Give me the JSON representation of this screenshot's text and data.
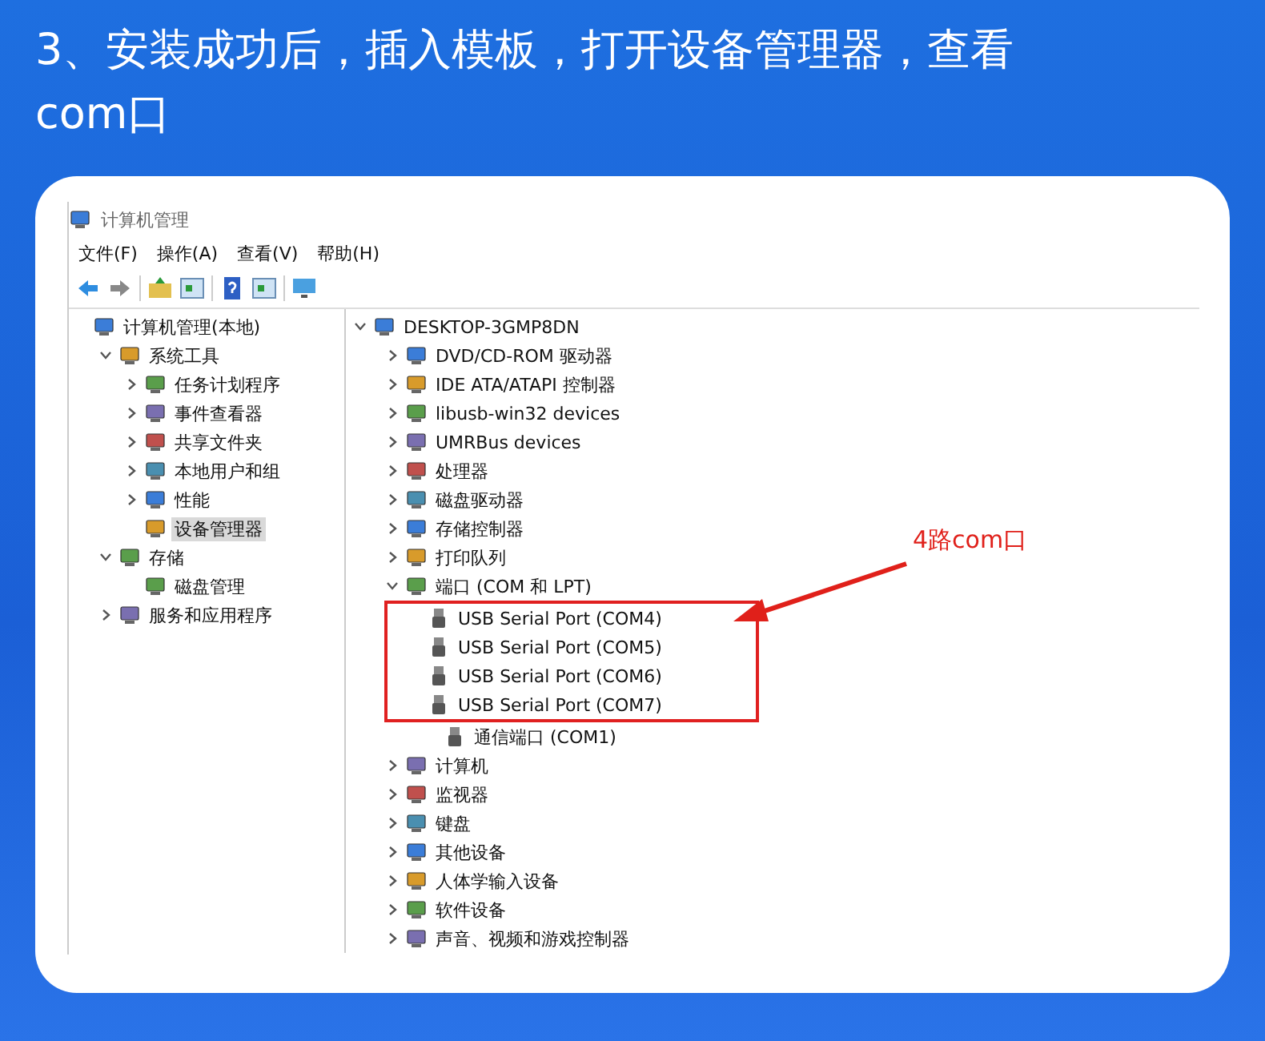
{
  "heading": {
    "lines": [
      "3、安装成功后，插入模板，打开设备管理器，查看",
      "com口"
    ]
  },
  "window": {
    "title": "计算机管理",
    "menu": [
      "文件(F)",
      "操作(A)",
      "查看(V)",
      "帮助(H)"
    ],
    "left_tree": [
      {
        "label": "计算机管理(本地)",
        "selected": false,
        "children": [
          {
            "label": "系统工具",
            "selected": false,
            "expanded": true,
            "children": [
              {
                "label": "任务计划程序",
                "selected": false,
                "expanded": false
              },
              {
                "label": "事件查看器",
                "selected": false,
                "expanded": false
              },
              {
                "label": "共享文件夹",
                "selected": false,
                "expanded": false
              },
              {
                "label": "本地用户和组",
                "selected": false,
                "expanded": false
              },
              {
                "label": "性能",
                "selected": false,
                "expanded": false
              },
              {
                "label": "设备管理器",
                "selected": true
              }
            ]
          },
          {
            "label": "存储",
            "selected": false,
            "expanded": true,
            "children": [
              {
                "label": "磁盘管理",
                "selected": false
              }
            ]
          },
          {
            "label": "服务和应用程序",
            "selected": false,
            "expanded": false
          }
        ]
      }
    ],
    "device_tree": {
      "label": "DESKTOP-3GMP8DN",
      "expanded": true,
      "children": [
        {
          "label": "DVD/CD-ROM 驱动器",
          "expanded": false
        },
        {
          "label": "IDE ATA/ATAPI 控制器",
          "expanded": false
        },
        {
          "label": "libusb-win32 devices",
          "expanded": false
        },
        {
          "label": "UMRBus devices",
          "expanded": false
        },
        {
          "label": "处理器",
          "expanded": false
        },
        {
          "label": "磁盘驱动器",
          "expanded": false
        },
        {
          "label": "存储控制器",
          "expanded": false
        },
        {
          "label": "打印队列",
          "expanded": false
        },
        {
          "label": "端口 (COM 和 LPT)",
          "expanded": true,
          "children": [
            {
              "label": "USB Serial Port (COM4)",
              "highlighted": true
            },
            {
              "label": "USB Serial Port (COM5)",
              "highlighted": true
            },
            {
              "label": "USB Serial Port (COM6)",
              "highlighted": true
            },
            {
              "label": "USB Serial Port (COM7)",
              "highlighted": true
            },
            {
              "label": "通信端口 (COM1)",
              "highlighted": false
            }
          ]
        },
        {
          "label": "计算机",
          "expanded": false
        },
        {
          "label": "监视器",
          "expanded": false
        },
        {
          "label": "键盘",
          "expanded": false
        },
        {
          "label": "其他设备",
          "expanded": false
        },
        {
          "label": "人体学输入设备",
          "expanded": false
        },
        {
          "label": "软件设备",
          "expanded": false
        },
        {
          "label": "声音、视频和游戏控制器",
          "expanded": false
        }
      ]
    }
  },
  "annotation": {
    "label": "4路com口"
  }
}
